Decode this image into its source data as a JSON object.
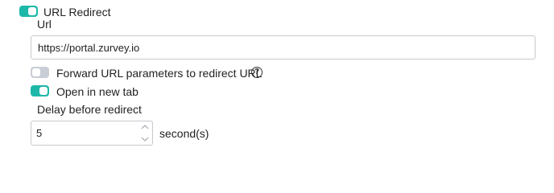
{
  "url_redirect": {
    "enabled": true,
    "label": "URL Redirect"
  },
  "url_field": {
    "label": "Url",
    "value": "https://portal.zurvey.io"
  },
  "forward_params": {
    "enabled": false,
    "label": "Forward URL parameters to redirect URL",
    "help_icon": "question-circle-icon",
    "help_glyph": "?"
  },
  "open_new_tab": {
    "enabled": true,
    "label": "Open in new tab"
  },
  "delay": {
    "label": "Delay before redirect",
    "value": "5",
    "unit": "second(s)"
  },
  "colors": {
    "toggle_on": "#1eb8a9",
    "toggle_off": "#c9ced6",
    "border": "#c6c9ce"
  }
}
